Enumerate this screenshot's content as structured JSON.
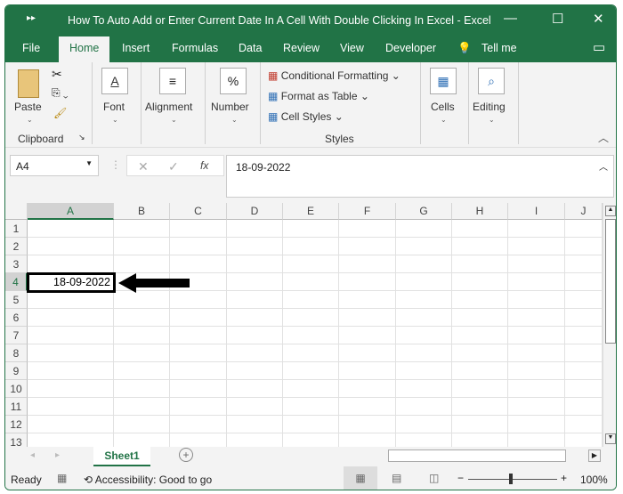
{
  "title_bar": {
    "title": "How To Auto Add or Enter Current Date In A Cell With Double Clicking In Excel  -  Excel",
    "minimize": "—",
    "maximize": "☐",
    "close": "✕",
    "quick_access": "▸▸"
  },
  "tabs": [
    {
      "label": "File"
    },
    {
      "label": "Home"
    },
    {
      "label": "Insert"
    },
    {
      "label": "Formulas"
    },
    {
      "label": "Data"
    },
    {
      "label": "Review"
    },
    {
      "label": "View"
    },
    {
      "label": "Developer"
    },
    {
      "label": "Tell me"
    }
  ],
  "ribbon": {
    "paste": "Paste",
    "clipboard": "Clipboard",
    "font": "Font",
    "alignment": "Alignment",
    "number": "Number",
    "conditional_formatting": "Conditional Formatting",
    "format_as_table": "Format as Table",
    "cell_styles": "Cell Styles",
    "styles": "Styles",
    "cells": "Cells",
    "editing": "Editing"
  },
  "formula_bar": {
    "name_box": "A4",
    "fx": "fx",
    "value": "18-09-2022"
  },
  "columns": [
    "A",
    "B",
    "C",
    "D",
    "E",
    "F",
    "G",
    "H",
    "I",
    "J"
  ],
  "rows": [
    "1",
    "2",
    "3",
    "4",
    "5",
    "6",
    "7",
    "8",
    "9",
    "10",
    "11",
    "12",
    "13"
  ],
  "cells": {
    "A4": "18-09-2022"
  },
  "sheet_tabs": [
    {
      "label": "Sheet1"
    }
  ],
  "status": {
    "ready": "Ready",
    "accessibility": "Accessibility: Good to go",
    "zoom": "100%"
  }
}
